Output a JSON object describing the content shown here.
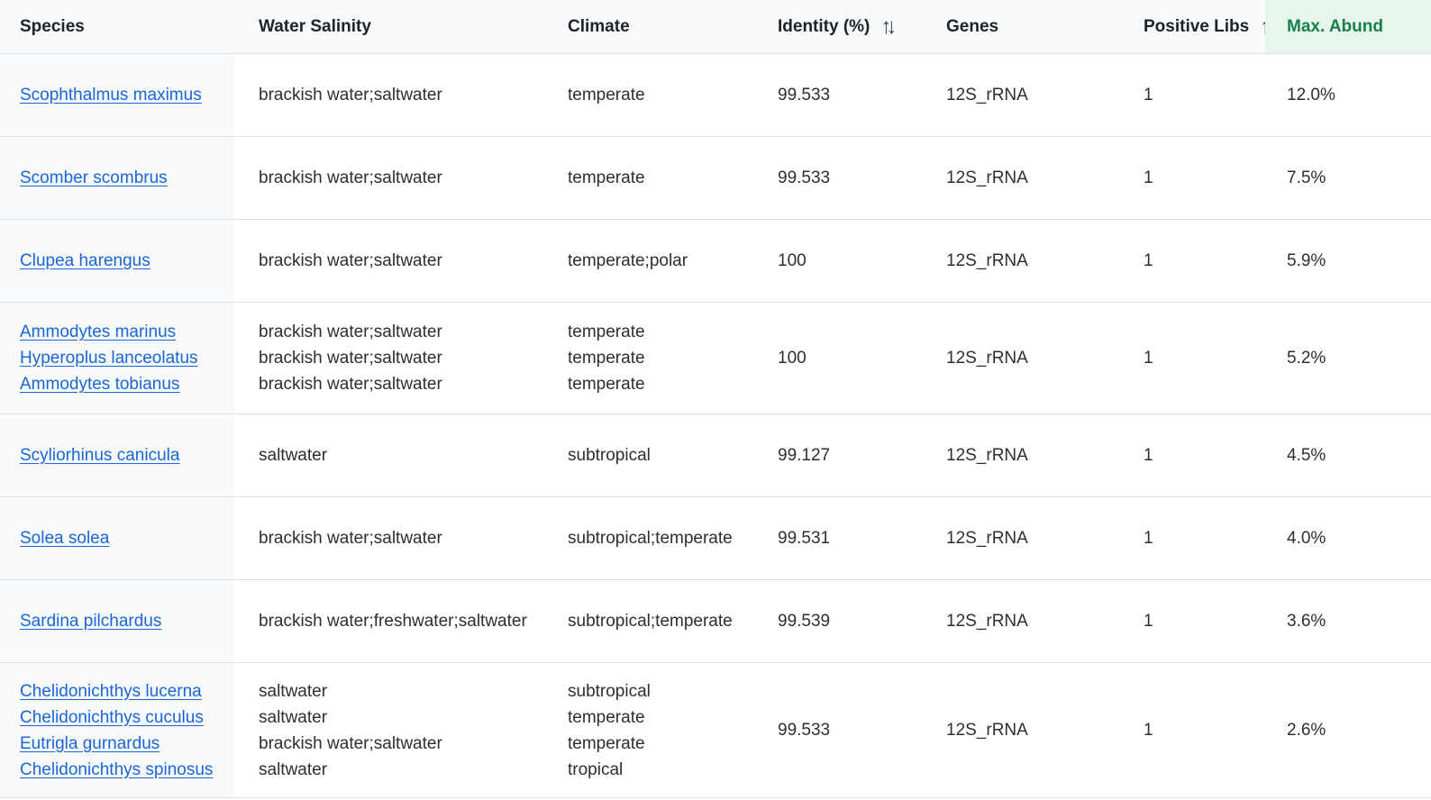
{
  "table": {
    "headers": {
      "species": "Species",
      "salinity": "Water Salinity",
      "climate": "Climate",
      "identity": "Identity (%)",
      "genes": "Genes",
      "libs": "Positive Libs",
      "abund": "Max. Abund",
      "sort_glyph": "↑↓"
    },
    "rows": [
      {
        "species": [
          "Scophthalmus maximus"
        ],
        "salinity": [
          "brackish water;saltwater"
        ],
        "climate": [
          "temperate"
        ],
        "identity": "99.533",
        "genes": "12S_rRNA",
        "libs": "1",
        "abund": "12.0%"
      },
      {
        "species": [
          "Scomber scombrus"
        ],
        "salinity": [
          "brackish water;saltwater"
        ],
        "climate": [
          "temperate"
        ],
        "identity": "99.533",
        "genes": "12S_rRNA",
        "libs": "1",
        "abund": "7.5%"
      },
      {
        "species": [
          "Clupea harengus"
        ],
        "salinity": [
          "brackish water;saltwater"
        ],
        "climate": [
          "temperate;polar"
        ],
        "identity": "100",
        "genes": "12S_rRNA",
        "libs": "1",
        "abund": "5.9%"
      },
      {
        "species": [
          "Ammodytes marinus",
          "Hyperoplus lanceolatus",
          "Ammodytes tobianus"
        ],
        "salinity": [
          "brackish water;saltwater",
          "brackish water;saltwater",
          "brackish water;saltwater"
        ],
        "climate": [
          "temperate",
          "temperate",
          "temperate"
        ],
        "identity": "100",
        "genes": "12S_rRNA",
        "libs": "1",
        "abund": "5.2%"
      },
      {
        "species": [
          "Scyliorhinus canicula"
        ],
        "salinity": [
          "saltwater"
        ],
        "climate": [
          "subtropical"
        ],
        "identity": "99.127",
        "genes": "12S_rRNA",
        "libs": "1",
        "abund": "4.5%"
      },
      {
        "species": [
          "Solea solea"
        ],
        "salinity": [
          "brackish water;saltwater"
        ],
        "climate": [
          "subtropical;temperate"
        ],
        "identity": "99.531",
        "genes": "12S_rRNA",
        "libs": "1",
        "abund": "4.0%"
      },
      {
        "species": [
          "Sardina pilchardus"
        ],
        "salinity": [
          "brackish water;freshwater;saltwater"
        ],
        "climate": [
          "subtropical;temperate"
        ],
        "identity": "99.539",
        "genes": "12S_rRNA",
        "libs": "1",
        "abund": "3.6%"
      },
      {
        "species": [
          "Chelidonichthys lucerna",
          "Chelidonichthys cuculus",
          "Eutrigla gurnardus",
          "Chelidonichthys spinosus"
        ],
        "salinity": [
          "saltwater",
          "saltwater",
          "brackish water;saltwater",
          "saltwater"
        ],
        "climate": [
          "subtropical",
          "temperate",
          "temperate",
          "tropical"
        ],
        "identity": "99.533",
        "genes": "12S_rRNA",
        "libs": "1",
        "abund": "2.6%"
      }
    ]
  },
  "colors": {
    "link": "#1a66d6",
    "active_header_bg": "#e7f6ec",
    "active_header_text": "#17804a"
  }
}
